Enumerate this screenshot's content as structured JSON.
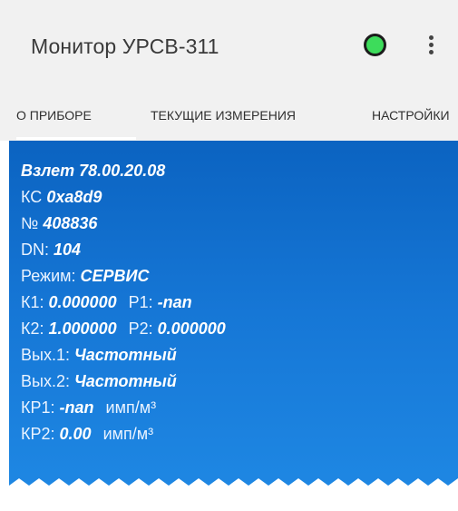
{
  "app": {
    "title": "Монитор УРСВ-311",
    "status_color": "#3ddc5b"
  },
  "tabs": [
    {
      "label": "О ПРИБОРЕ",
      "active": true
    },
    {
      "label": "ТЕКУЩИЕ ИЗМЕРЕНИЯ",
      "active": false
    },
    {
      "label": "НАСТРОЙКИ",
      "active": false
    }
  ],
  "device": {
    "model": "Взлет 78.00.20.08",
    "ks_label": "КС",
    "ks_value": "0xa8d9",
    "number_label": "№",
    "number_value": "408836",
    "dn_label": "DN:",
    "dn_value": "104",
    "mode_label": "Режим:",
    "mode_value": "СЕРВИС",
    "k1_label": "К1:",
    "k1_value": "0.000000",
    "p1_label": "Р1:",
    "p1_value": "-nan",
    "k2_label": "К2:",
    "k2_value": "1.000000",
    "p2_label": "Р2:",
    "p2_value": "0.000000",
    "out1_label": "Вых.1:",
    "out1_value": "Частотный",
    "out2_label": "Вых.2:",
    "out2_value": "Частотный",
    "kp1_label": "КР1:",
    "kp1_value": "-nan",
    "kp1_unit": "имп/м³",
    "kp2_label": "КР2:",
    "kp2_value": "0.00",
    "kp2_unit": "имп/м³"
  },
  "colors": {
    "appbar_bg": "#f1f1f1",
    "panel_top": "#0b63c1",
    "panel_bottom": "#1e87e3"
  }
}
